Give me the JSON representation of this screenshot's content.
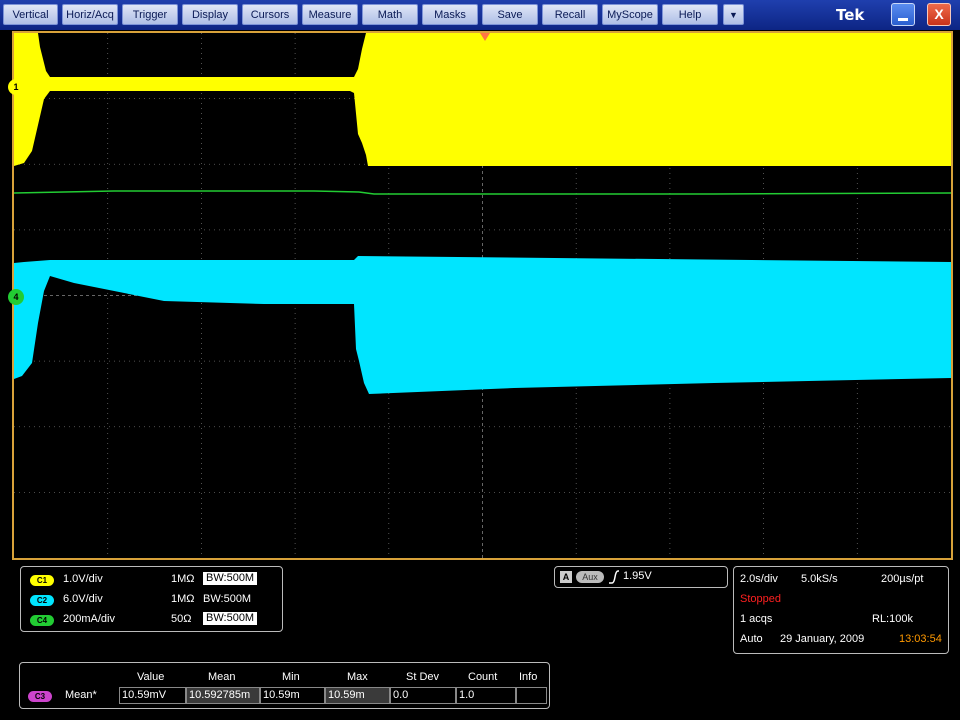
{
  "menu": {
    "items": [
      "Vertical",
      "Horiz/Acq",
      "Trigger",
      "Display",
      "Cursors",
      "Measure",
      "Math",
      "Masks",
      "Save",
      "Recall",
      "MyScope",
      "Help"
    ],
    "dropdown_glyph": "▼",
    "brand": "Tek",
    "minimize_icon": "minimize-icon",
    "close_glyph": "X"
  },
  "markers": {
    "ch1": "1",
    "ch4": "4"
  },
  "colors": {
    "ch1": "#ffff00",
    "ch2": "#00e5ff",
    "ch3": "#cc44cc",
    "ch4": "#22cc33",
    "accent_border": "#d8a23a",
    "stopped": "#ff2020",
    "time": "#ff9900"
  },
  "channels": [
    {
      "id": "C1",
      "scale": "1.0V/div",
      "impedance": "1MΩ",
      "bw": "W:500M",
      "color": "#ffff00"
    },
    {
      "id": "C2",
      "scale": "6.0V/div",
      "impedance": "1MΩ",
      "bw": "W:500M",
      "color": "#00e5ff"
    },
    {
      "id": "C4",
      "scale": "200mA/div",
      "impedance": "50Ω",
      "bw": "W:500M",
      "color": "#22cc33"
    }
  ],
  "bw_prefix": "B",
  "trigger": {
    "source_label": "A",
    "source": "Aux",
    "level": "1.95V"
  },
  "acquisition": {
    "time_div": "2.0s/div",
    "sample_rate": "5.0kS/s",
    "resolution": "200µs/pt",
    "status": "Stopped",
    "acqs": "1 acqs",
    "record_length": "RL:100k",
    "mode": "Auto",
    "date": "29 January, 2009",
    "time": "13:03:54"
  },
  "measurement": {
    "headers": [
      "Value",
      "Mean",
      "Min",
      "Max",
      "St Dev",
      "Count",
      "Info"
    ],
    "channel": "C3",
    "label": "Mean*",
    "values": [
      "10.59mV",
      "10.592785m",
      "10.59m",
      "10.59m",
      "0.0",
      "1.0",
      ""
    ]
  }
}
